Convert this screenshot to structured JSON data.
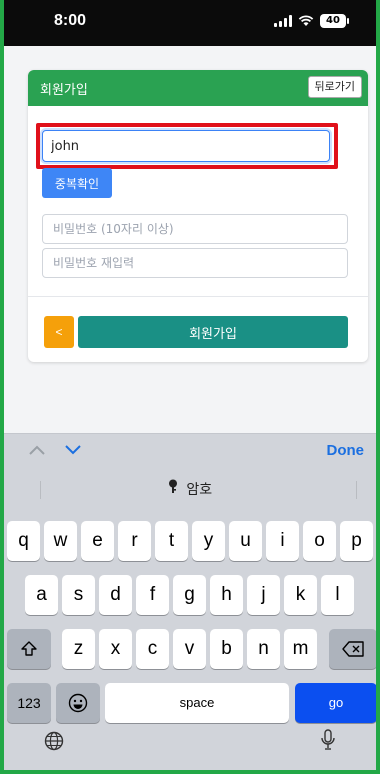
{
  "status": {
    "time": "8:00",
    "battery": "40"
  },
  "card": {
    "title": "회원가입",
    "back_label": "뒤로가기",
    "username_value": "john",
    "dup_check_label": "중복확인",
    "password_placeholder": "비밀번호 (10자리 이상)",
    "password_confirm_placeholder": "비밀번호 재입력",
    "prev_label": "<",
    "signup_label": "회원가입"
  },
  "toolbar": {
    "done_label": "Done"
  },
  "keyboard": {
    "suggestion": "암호",
    "row1": [
      "q",
      "w",
      "e",
      "r",
      "t",
      "y",
      "u",
      "i",
      "o",
      "p"
    ],
    "row2": [
      "a",
      "s",
      "d",
      "f",
      "g",
      "h",
      "j",
      "k",
      "l"
    ],
    "row3": [
      "z",
      "x",
      "c",
      "v",
      "b",
      "n",
      "m"
    ],
    "numbers_label": "123",
    "space_label": "space",
    "go_label": "go"
  },
  "colors": {
    "header": "#2aa252",
    "signup": "#1a9085",
    "prev": "#f5a00a",
    "dup_check": "#3e86f6",
    "go": "#0b4ff0",
    "highlight": "#e0101a"
  }
}
